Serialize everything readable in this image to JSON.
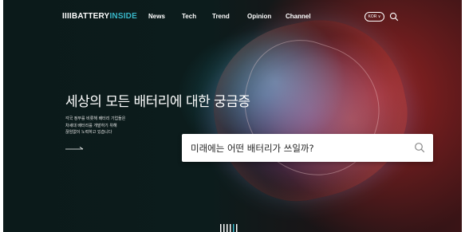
{
  "header": {
    "logo_prefix": "IIII",
    "logo_main": "BATTERY",
    "logo_accent": "INSIDE",
    "nav": [
      "News",
      "Tech",
      "Trend",
      "Opinion",
      "Channel"
    ],
    "lang": "KOR ∨"
  },
  "hero": {
    "headline": "세상의 모든 배터리에 대한 궁금증",
    "description": [
      "각국 정부를 비롯해 배터리 기업들은",
      "차세대 배터리를 개발하기 위해",
      "끊임없이 노력하고 있습니다"
    ]
  },
  "search": {
    "value": "미래에는 어떤 배터리가 쓰일까?"
  },
  "pager": {
    "label": "IIII"
  },
  "colors": {
    "accent": "#38b6c8",
    "background_dark": "#0c1c1c",
    "background_red": "#c22a2a"
  },
  "icons": [
    "search-icon",
    "arrow-right-icon",
    "chevron-down-icon"
  ]
}
